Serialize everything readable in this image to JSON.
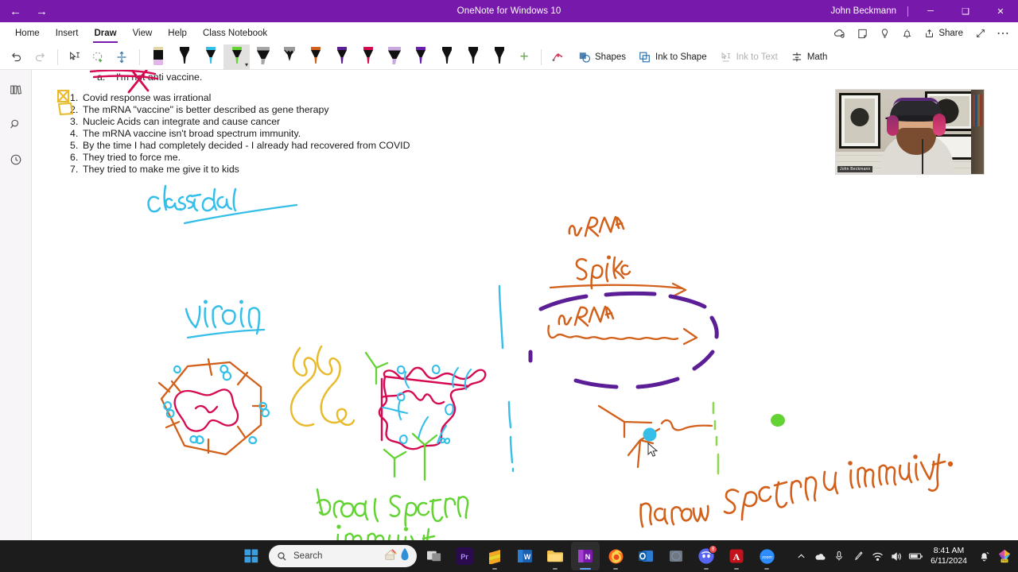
{
  "window": {
    "title": "OneNote for Windows 10",
    "user": "John Beckmann",
    "back_icon": "back-arrow-icon",
    "forward_icon": "forward-arrow-icon",
    "minimize_label": "─",
    "maximize_label": "❑",
    "close_label": "✕"
  },
  "menu": {
    "items": [
      {
        "label": "Home",
        "active": false
      },
      {
        "label": "Insert",
        "active": false
      },
      {
        "label": "Draw",
        "active": true
      },
      {
        "label": "View",
        "active": false
      },
      {
        "label": "Help",
        "active": false
      },
      {
        "label": "Class Notebook",
        "active": false
      }
    ]
  },
  "ribbon_right": {
    "sync_icon": "cloud-sync-icon",
    "sticky_icon": "sticky-note-icon",
    "tell_me_icon": "lightbulb-icon",
    "notify_icon": "bell-icon",
    "share_label": "Share",
    "share_icon": "share-icon",
    "expand_icon": "full-page-view-icon",
    "more_icon": "more-options-icon"
  },
  "pentool": {
    "undo_label": "Undo",
    "redo_label": "Redo",
    "select_text_label": "Type",
    "lasso_label": "Lasso Select",
    "insert_space_label": "Insert Space",
    "add_pen_label": "+",
    "pens": [
      {
        "name": "eraser",
        "barrel": "#111111",
        "tip": "#e2b6e8",
        "cap": "#e4d7a8",
        "type": "eraser",
        "selected": false
      },
      {
        "name": "pen-black",
        "barrel": "#111111",
        "tip": "#111111",
        "cap": "#111111",
        "type": "pen",
        "selected": false
      },
      {
        "name": "pen-cyan",
        "barrel": "#111111",
        "tip": "#35bfe8",
        "cap": "#35bfe8",
        "type": "pen",
        "selected": false
      },
      {
        "name": "pen-green",
        "barrel": "#111111",
        "tip": "#62d332",
        "cap": "#62d332",
        "type": "pen",
        "selected": true
      },
      {
        "name": "highlighter-grey",
        "barrel": "#111111",
        "tip": "#a6a6a6",
        "cap": "#a6a6a6",
        "type": "highlighter",
        "selected": false
      },
      {
        "name": "pencil-grey",
        "barrel": "#111111",
        "tip": "#9b9b9b",
        "cap": "#9b9b9b",
        "type": "pencil",
        "selected": false
      },
      {
        "name": "pen-orange",
        "barrel": "#111111",
        "tip": "#d2601a",
        "cap": "#d2601a",
        "type": "pen",
        "selected": false
      },
      {
        "name": "pen-purple",
        "barrel": "#111111",
        "tip": "#5b1e96",
        "cap": "#5b1e96",
        "type": "pen",
        "selected": false
      },
      {
        "name": "pen-magenta",
        "barrel": "#111111",
        "tip": "#d60a52",
        "cap": "#d60a52",
        "type": "pen",
        "selected": false
      },
      {
        "name": "highlighter-lilac",
        "barrel": "#111111",
        "tip": "#cba8e0",
        "cap": "#cba8e0",
        "type": "highlighter",
        "selected": false
      },
      {
        "name": "pen-violet",
        "barrel": "#111111",
        "tip": "#6a1fb0",
        "cap": "#6a1fb0",
        "type": "pen",
        "selected": false
      },
      {
        "name": "pen-black-2",
        "barrel": "#111111",
        "tip": "#111111",
        "cap": "#111111",
        "type": "pen",
        "selected": false
      },
      {
        "name": "pen-black-3",
        "barrel": "#111111",
        "tip": "#111111",
        "cap": "#111111",
        "type": "pen",
        "selected": false
      },
      {
        "name": "pen-black-4",
        "barrel": "#111111",
        "tip": "#111111",
        "cap": "#111111",
        "type": "pen",
        "selected": false
      }
    ],
    "tools": [
      {
        "label": "Shapes",
        "icon": "shapes-icon",
        "disabled": false
      },
      {
        "label": "Ink to Shape",
        "icon": "ink-to-shape-icon",
        "disabled": false
      },
      {
        "label": "Ink to Text",
        "icon": "ink-to-text-icon",
        "disabled": true
      },
      {
        "label": "Math",
        "icon": "math-icon",
        "disabled": false
      }
    ],
    "ink_replay_icon": "ink-replay-icon"
  },
  "rail": {
    "items": [
      {
        "name": "notebooks-icon",
        "label": "Notebooks"
      },
      {
        "name": "search-icon",
        "label": "Search"
      },
      {
        "name": "recent-icon",
        "label": "Recent Notes"
      }
    ]
  },
  "page": {
    "sub_item": {
      "marker": "a.",
      "text": "I'm not anti vaccine."
    },
    "list": [
      {
        "num": "1.",
        "text": "Covid response was irrational"
      },
      {
        "num": "2.",
        "text": "The mRNA \"vaccine\" is better described as gene therapy"
      },
      {
        "num": "3.",
        "text": "Nucleic Acids can integrate and cause cancer"
      },
      {
        "num": "4.",
        "text": "The mRNA vaccine isn't broad spectrum immunity."
      },
      {
        "num": "5.",
        "text": "By the time I had completely decided - I already had recovered from COVID"
      },
      {
        "num": "6.",
        "text": "They tried to force me."
      },
      {
        "num": "7.",
        "text": "They tried to make me give it to kids"
      }
    ],
    "ink_labels": {
      "classical": "Classical",
      "virion": "virion",
      "mrna_spike_title": "mRNA",
      "spike": "Spike",
      "mrna_strand": "mRNA",
      "broad": "broad  spectrum",
      "broad2": "immunity",
      "narrow": "narrow",
      "narrow2": "spectrum immunity."
    },
    "ink_colors": {
      "cyan": "#35bfe8",
      "orange": "#d2601a",
      "magenta": "#d60a52",
      "green": "#62d332",
      "purple": "#5b1e96",
      "yellow": "#e8bb2d"
    }
  },
  "webcam": {
    "participant_name": "John Beckmann"
  },
  "taskbar": {
    "start_label": "Start",
    "search_placeholder": "Search",
    "search_icon": "search-icon",
    "apps": [
      {
        "name": "task-view-icon",
        "label": "Task View",
        "state": "idle",
        "badge": ""
      },
      {
        "name": "premiere-pro-icon",
        "label": "Adobe Premiere Pro",
        "state": "idle",
        "badge": ""
      },
      {
        "name": "sublime-text-icon",
        "label": "Sublime Text",
        "state": "open",
        "badge": ""
      },
      {
        "name": "word-icon",
        "label": "Microsoft Word",
        "state": "idle",
        "badge": ""
      },
      {
        "name": "file-explorer-icon",
        "label": "File Explorer",
        "state": "open",
        "badge": ""
      },
      {
        "name": "onenote-icon",
        "label": "OneNote",
        "state": "active",
        "badge": ""
      },
      {
        "name": "firefox-icon",
        "label": "Firefox",
        "state": "open",
        "badge": ""
      },
      {
        "name": "outlook-icon",
        "label": "Outlook",
        "state": "idle",
        "badge": ""
      },
      {
        "name": "teams-icon",
        "label": "Microsoft Teams",
        "state": "idle",
        "badge": ""
      },
      {
        "name": "discord-icon",
        "label": "Discord",
        "state": "open",
        "badge": "8"
      },
      {
        "name": "acrobat-icon",
        "label": "Adobe Acrobat",
        "state": "open",
        "badge": ""
      },
      {
        "name": "zoom-icon",
        "label": "Zoom",
        "state": "open",
        "badge": ""
      }
    ],
    "tray": {
      "overflow_icon": "chevron-up-icon",
      "onedrive_icon": "onedrive-icon",
      "mic_icon": "microphone-icon",
      "pen_icon": "pen-icon",
      "wifi_icon": "wifi-icon",
      "volume_icon": "volume-icon",
      "battery_icon": "battery-icon",
      "time": "8:41 AM",
      "date": "6/11/2024",
      "notification_icon": "notification-bell-icon",
      "extra_icon": "prism-app-icon"
    }
  }
}
